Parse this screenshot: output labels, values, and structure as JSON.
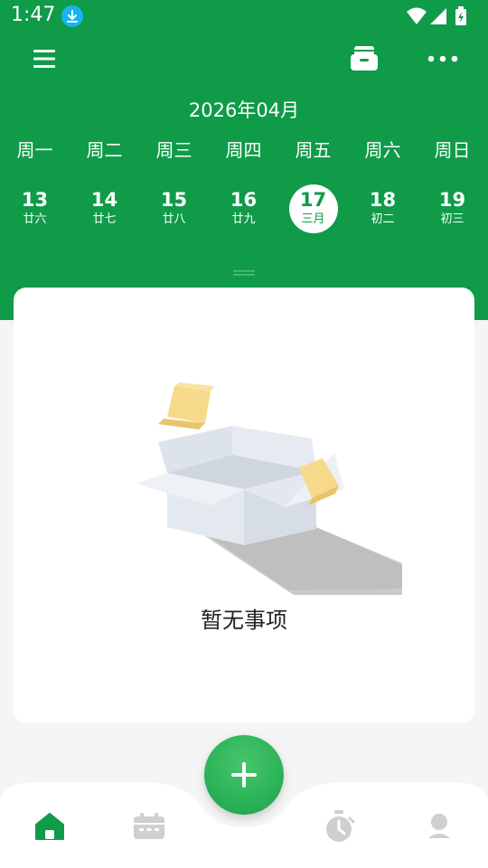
{
  "status_bar": {
    "time": "1:47"
  },
  "header": {
    "month_title": "2026年04月",
    "weekdays": [
      "周一",
      "周二",
      "周三",
      "周四",
      "周五",
      "周六",
      "周日"
    ],
    "days": [
      {
        "num": "13",
        "lunar": "廿六"
      },
      {
        "num": "14",
        "lunar": "廿七"
      },
      {
        "num": "15",
        "lunar": "廿八"
      },
      {
        "num": "16",
        "lunar": "廿九"
      },
      {
        "num": "17",
        "lunar": "三月"
      },
      {
        "num": "18",
        "lunar": "初二"
      },
      {
        "num": "19",
        "lunar": "初三"
      }
    ],
    "selected_day": "17"
  },
  "empty_state": {
    "message": "暂无事项"
  },
  "icons": {
    "menu": "menu-icon",
    "archive": "archive-box-icon",
    "more": "more-dots-icon",
    "fab": "plus-icon",
    "nav": [
      "home-icon",
      "calendar-icon",
      "stopwatch-icon",
      "profile-icon"
    ]
  },
  "colors": {
    "primary": "#0f9b48",
    "fab": "#2db55a",
    "nav_active": "#0f9b48",
    "nav_inactive": "#cfcfcf"
  }
}
